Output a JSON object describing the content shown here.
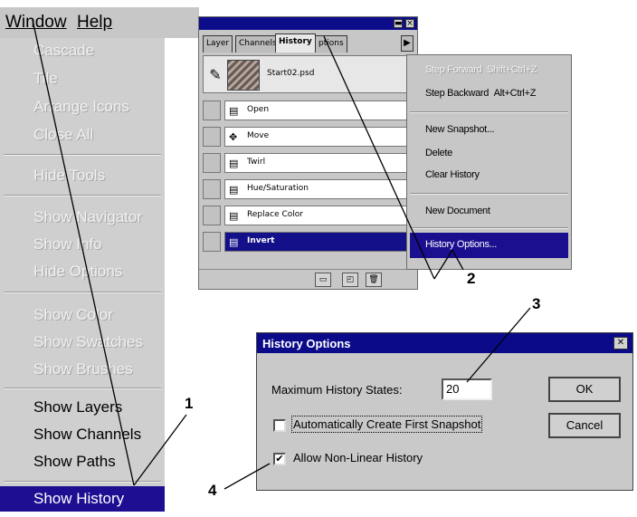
{
  "menubar": {
    "window_label": "Window",
    "help_label": "Help"
  },
  "window_menu": {
    "group1": [
      "Cascade",
      "Tile",
      "Arrange Icons",
      "Close All"
    ],
    "group2": [
      "Hide Tools"
    ],
    "group3": [
      "Show Navigator",
      "Show Info",
      "Hide Options"
    ],
    "group4": [
      "Show Color",
      "Show Swatches",
      "Show Brushes"
    ],
    "group5": [
      "Show Layers",
      "Show Channels",
      "Show Paths"
    ],
    "selected": "Show History"
  },
  "palette": {
    "tabs": [
      "Layer",
      "Channels",
      "History",
      "ptions"
    ],
    "snapshot_name": "Start02.psd",
    "steps": [
      "Open",
      "Move",
      "Twirl",
      "Hue/Saturation",
      "Replace Color",
      "Invert"
    ],
    "selected_step": "Invert"
  },
  "flyout": {
    "step_forward": "Step Forward",
    "step_forward_key": "Shift+Ctrl+Z",
    "step_backward": "Step Backward",
    "step_backward_key": "Alt+Ctrl+Z",
    "new_snapshot": "New Snapshot...",
    "delete": "Delete",
    "clear_history": "Clear History",
    "new_document": "New Document",
    "history_options": "History Options..."
  },
  "dialog": {
    "title": "History Options",
    "max_states_label": "Maximum History States:",
    "max_states_value": "20",
    "auto_snapshot_label": "Automatically Create First Snapshot",
    "auto_snapshot_checked": false,
    "nonlinear_label": "Allow Non-Linear History",
    "nonlinear_checked": true,
    "ok_label": "OK",
    "cancel_label": "Cancel"
  },
  "callouts": [
    "1",
    "2",
    "3",
    "4"
  ],
  "colors": {
    "selection": "#1d0e92",
    "chrome": "#c7c7c7",
    "titlebar": "#0b0b8a"
  }
}
